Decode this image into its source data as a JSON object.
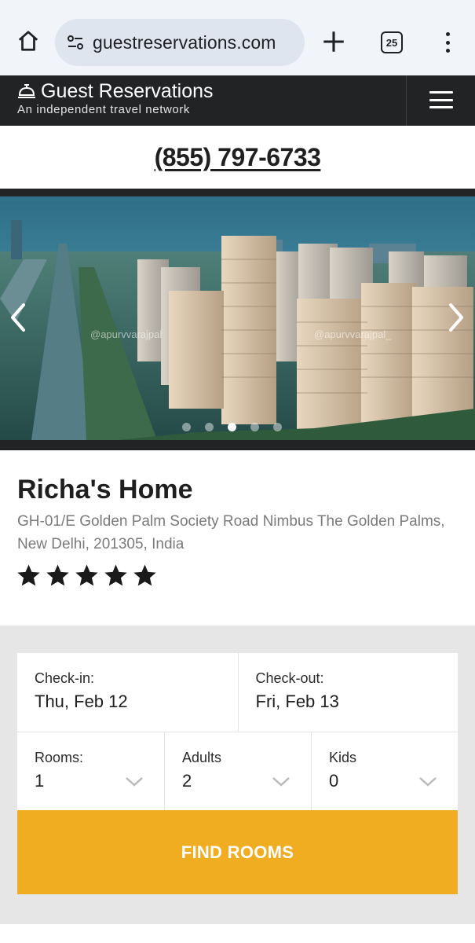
{
  "browser": {
    "url": "guestreservations.com",
    "tab_count": "25",
    "icons": [
      "home-icon",
      "site-settings-icon",
      "new-tab-icon",
      "tab-switcher-icon",
      "more-options-icon"
    ]
  },
  "header": {
    "brand_title": "Guest Reservations",
    "brand_tagline": "An independent travel network",
    "icons": [
      "bell-icon",
      "menu-icon"
    ]
  },
  "phone": "(855) 797-6733",
  "carousel": {
    "watermarks": [
      "@apurvvarajpal",
      "@apurvvarajpal_"
    ],
    "slide_count": 5,
    "active_slide": 3,
    "icons": [
      "arrow-left-icon",
      "arrow-right-icon"
    ]
  },
  "property": {
    "name": "Richa's Home",
    "address": "GH-01/E Golden Palm Society Road Nimbus The Golden Palms, New Delhi, 201305, India",
    "rating": 5,
    "rating_max": 5
  },
  "booking": {
    "checkin_label": "Check-in:",
    "checkin_value": "Thu, Feb 12",
    "checkout_label": "Check-out:",
    "checkout_value": "Fri, Feb 13",
    "rooms_label": "Rooms:",
    "rooms_value": "1",
    "adults_label": "Adults",
    "adults_value": "2",
    "kids_label": "Kids",
    "kids_value": "0",
    "find_button": "FIND ROOMS"
  },
  "colors": {
    "header_bg": "#222325",
    "accent": "#f1ad22",
    "panel_bg": "#e6e6e6"
  }
}
